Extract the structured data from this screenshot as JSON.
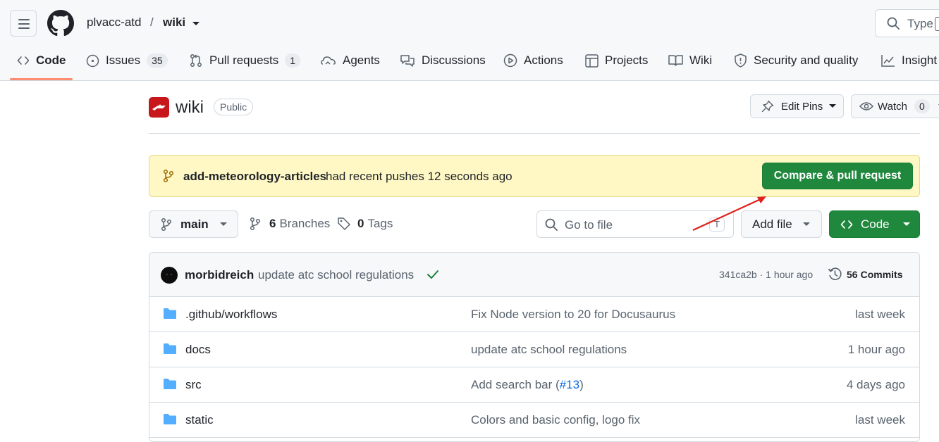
{
  "header": {
    "owner": "plvacc-atd",
    "separator": "/",
    "repo": "wiki",
    "search_placeholder": "Type"
  },
  "tabs": [
    {
      "label": "Code",
      "icon": "code-icon",
      "selected": true
    },
    {
      "label": "Issues",
      "icon": "issue-icon",
      "count": "35"
    },
    {
      "label": "Pull requests",
      "icon": "pull-request-icon",
      "count": "1"
    },
    {
      "label": "Agents",
      "icon": "agents-icon"
    },
    {
      "label": "Discussions",
      "icon": "discussions-icon"
    },
    {
      "label": "Actions",
      "icon": "actions-play-icon"
    },
    {
      "label": "Projects",
      "icon": "projects-table-icon"
    },
    {
      "label": "Wiki",
      "icon": "book-icon"
    },
    {
      "label": "Security and quality",
      "icon": "shield-icon"
    },
    {
      "label": "Insight",
      "icon": "graph-icon"
    }
  ],
  "repo_head": {
    "name": "wiki",
    "visibility": "Public",
    "edit_pins": "Edit Pins",
    "watch": "Watch",
    "watch_count": "0"
  },
  "banner": {
    "branch": "add-meteorology-articles",
    "text": "had recent pushes 12 seconds ago",
    "button": "Compare & pull request"
  },
  "toolbar": {
    "branch": "main",
    "branches_count": "6",
    "branches_label": "Branches",
    "tags_count": "0",
    "tags_label": "Tags",
    "goto_placeholder": "Go to file",
    "goto_shortcut": "T",
    "add_file": "Add file",
    "code": "Code"
  },
  "commit": {
    "author": "morbidreich",
    "message": "update atc school regulations",
    "hash_time": "341ca2b · 1 hour ago",
    "commits_count": "56",
    "commits_label": "Commits"
  },
  "files": [
    {
      "name": ".github/workflows",
      "message": "Fix Node version to 20 for Docusaurus",
      "age": "last week"
    },
    {
      "name": "docs",
      "message": "update atc school regulations",
      "age": "1 hour ago"
    },
    {
      "name": "src",
      "message_prefix": "Add search bar (",
      "message_link": "#13",
      "message_suffix": ")",
      "age": "4 days ago"
    },
    {
      "name": "static",
      "message": "Colors and basic config, logo fix",
      "age": "last week"
    }
  ],
  "colors": {
    "accent_green": "#1f883d",
    "banner_bg": "#fff8c5",
    "tab_underline": "#fd8c73",
    "link": "#0969da",
    "folder": "#54aeff",
    "annotation_arrow": "#e0201b"
  }
}
